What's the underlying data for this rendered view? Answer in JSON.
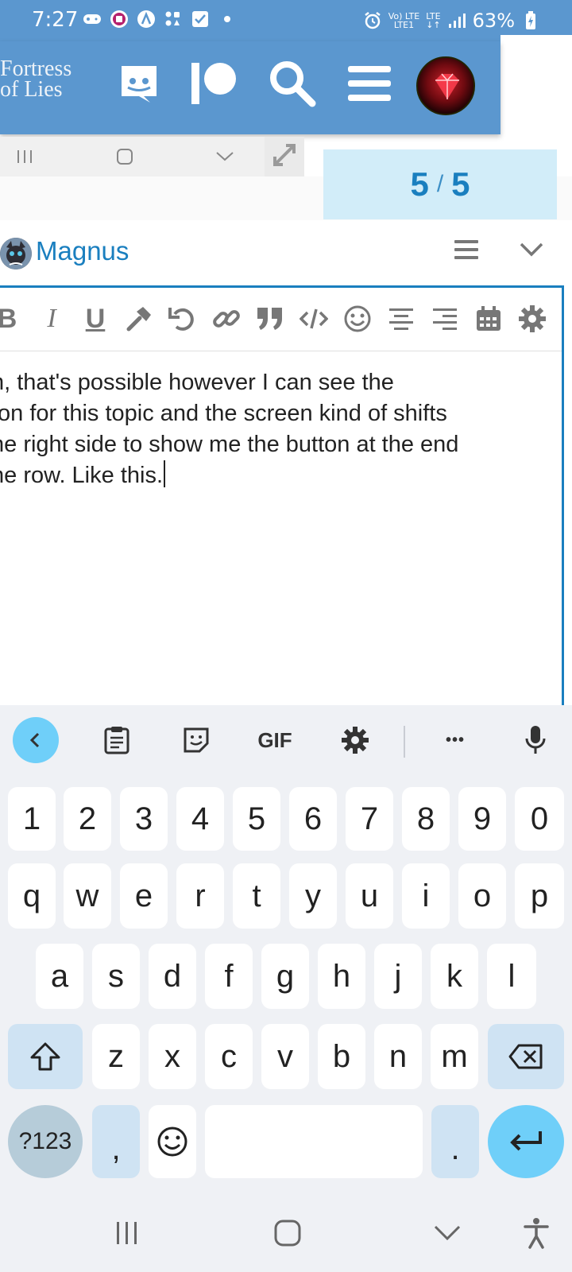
{
  "status_bar": {
    "time": "7:27",
    "battery": "63%",
    "network_top": "Vo) LTE",
    "network_bottom": "LTE1",
    "lte_label": "LTE"
  },
  "header": {
    "logo_line1": "Fortress",
    "logo_line2": "of Lies",
    "icons": [
      "discord-icon",
      "patreon-icon",
      "search-icon",
      "hamburger-menu-icon",
      "user-avatar"
    ],
    "background": "#5b97cf"
  },
  "topic_progress": {
    "current": "5",
    "separator": "/",
    "total": "5"
  },
  "composer": {
    "reply_to": "Magnus",
    "toolbar": [
      "bold",
      "italic",
      "underline",
      "hammer",
      "undo",
      "link",
      "quote",
      "code",
      "emoji",
      "align-center",
      "align-right",
      "calendar",
      "settings"
    ],
    "bold_label": "B",
    "italic_label": "I",
    "underline_label": "U",
    "text_lines": [
      "h, that's possible however I can see the",
      "ton for this topic and the screen kind of shifts",
      "he right side to show me the button at the end",
      "he row. Like this."
    ],
    "accent": "#1a7fbf"
  },
  "keyboard": {
    "top_row": [
      "back-icon",
      "clipboard-icon",
      "sticker-icon",
      "gif",
      "settings-icon",
      "more-icon",
      "microphone-icon"
    ],
    "gif_label": "GIF",
    "more_label": "•••",
    "number_row": [
      "1",
      "2",
      "3",
      "4",
      "5",
      "6",
      "7",
      "8",
      "9",
      "0"
    ],
    "row1": [
      "q",
      "w",
      "e",
      "r",
      "t",
      "y",
      "u",
      "i",
      "o",
      "p"
    ],
    "row2": [
      "a",
      "s",
      "d",
      "f",
      "g",
      "h",
      "j",
      "k",
      "l"
    ],
    "row3": [
      "z",
      "x",
      "c",
      "v",
      "b",
      "n",
      "m"
    ],
    "sym_label": "?123",
    "comma_label": ",",
    "period_label": ".",
    "enter_color": "#6fcff9"
  },
  "nav_bar": [
    "recent-apps-icon",
    "home-icon",
    "back-chevron-icon",
    "accessibility-icon"
  ]
}
